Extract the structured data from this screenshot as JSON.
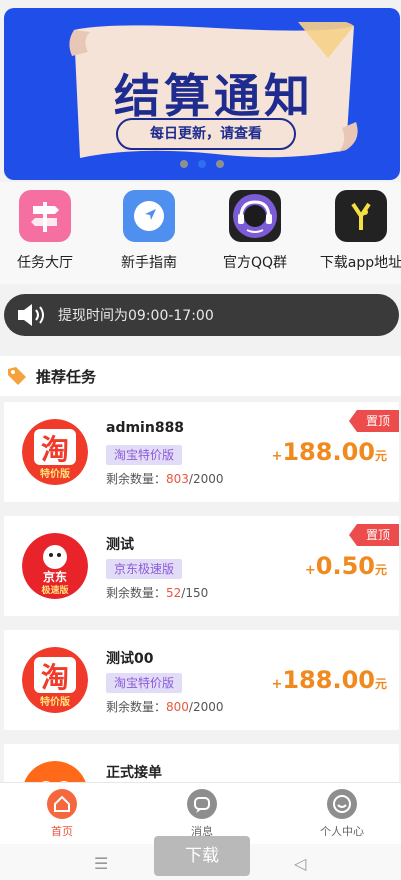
{
  "banner": {
    "title": "结算通知",
    "subtitle": "每日更新，请查看",
    "carousel_count": 3,
    "carousel_active": 2
  },
  "quick_nav": [
    {
      "label": "任务大厅",
      "icon": "signpost-icon",
      "color": "#f56fa0"
    },
    {
      "label": "新手指南",
      "icon": "compass-arrow-icon",
      "color": "#4e8ff0"
    },
    {
      "label": "官方QQ群",
      "icon": "headset-support-icon",
      "color": "#7b5bd6"
    },
    {
      "label": "下载app地址",
      "icon": "y-logo-icon",
      "color": "#222222"
    }
  ],
  "notice": {
    "text": "提现时间为09:00-17:00",
    "icon": "speaker-icon"
  },
  "section": {
    "title": "推荐任务",
    "icon": "tag-icon"
  },
  "tasks": [
    {
      "name": "admin888",
      "tag": "淘宝特价版",
      "stock_label": "剩余数量：",
      "remaining": "803",
      "total": "/2000",
      "price_plus": "+",
      "price": "188.00",
      "unit": "元",
      "pinned_label": "置顶",
      "pinned": true,
      "logo": "taobao-special-logo-icon",
      "logo_char": "淘",
      "logo_sub": "特价版"
    },
    {
      "name": "测试",
      "tag": "京东极速版",
      "stock_label": "剩余数量：",
      "remaining": "52",
      "total": "/150",
      "price_plus": "+",
      "price": "0.50",
      "unit": "元",
      "pinned_label": "置顶",
      "pinned": true,
      "logo": "jd-lite-logo-icon",
      "logo_char": "京东",
      "logo_sub": "极速版"
    },
    {
      "name": "测试00",
      "tag": "淘宝特价版",
      "stock_label": "剩余数量：",
      "remaining": "800",
      "total": "/2000",
      "price_plus": "+",
      "price": "188.00",
      "unit": "元",
      "pinned_label": "",
      "pinned": false,
      "logo": "taobao-special-logo-icon",
      "logo_char": "淘",
      "logo_sub": "特价版"
    },
    {
      "name": "正式接单",
      "logo": "orange-app-logo-icon"
    }
  ],
  "tabbar": [
    {
      "label": "首页",
      "icon": "home-icon",
      "active": true
    },
    {
      "label": "消息",
      "icon": "message-icon",
      "active": false
    },
    {
      "label": "个人中心",
      "icon": "profile-icon",
      "active": false
    }
  ],
  "download_button": "下载",
  "colors": {
    "banner_blue": "#1f4fe8",
    "price_orange": "#f08a1e",
    "pin_red": "#ec4c4c",
    "tag_purple": "#8a5cd8",
    "active_tab": "#e8573d"
  }
}
